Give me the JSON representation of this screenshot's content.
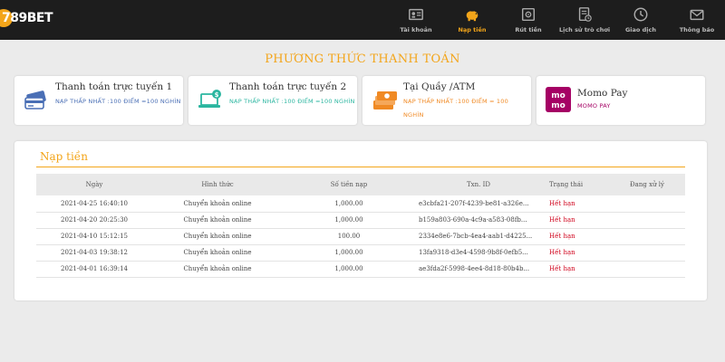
{
  "header": {
    "logo_text": "789BET",
    "nav": [
      {
        "label": "Tài khoản",
        "icon": "id-card-icon"
      },
      {
        "label": "Nạp tiền",
        "icon": "piggy-bank-icon",
        "active": true
      },
      {
        "label": "Rút tiền",
        "icon": "safe-icon"
      },
      {
        "label": "Lịch sử trò chơi",
        "icon": "history-document-icon"
      },
      {
        "label": "Giao dịch",
        "icon": "clock-icon"
      },
      {
        "label": "Thông báo",
        "icon": "envelope-icon"
      }
    ]
  },
  "page_title": "PHƯƠNG THỨC THANH TOÁN",
  "payment_methods": [
    {
      "name": "Thanh toán trực tuyến 1",
      "desc": "NẠP THẤP NHẤT :100 ĐIỂM =100 NGHÌN",
      "icon": "credit-cards-icon",
      "color": "#4a6fb5"
    },
    {
      "name": "Thanh toán trực tuyến 2",
      "desc": "NẠP THẤP NHẤT :100 ĐIỂM =100 NGHÌN",
      "icon": "laptop-dollar-icon",
      "color": "#2bb6a0"
    },
    {
      "name": "Tại Quầy /ATM",
      "desc": "NẠP THẤP NHẤT :100 ĐIỂM = 100 NGHÌN",
      "icon": "cash-stack-icon",
      "color": "#f08a24"
    },
    {
      "name": "Momo Pay",
      "desc": "MOMO PAY",
      "icon": "momo-logo-icon",
      "color": "#a50064"
    }
  ],
  "deposit": {
    "title": "Nạp tiền",
    "columns": [
      "Ngày",
      "Hình thức",
      "Số tiền nạp",
      "Txn. ID",
      "Trạng thái",
      "Đang xử lý"
    ],
    "rows": [
      [
        "2021-04-25 16:40:10",
        "Chuyển khoản online",
        "1,000.00",
        "e3cbfa21-207f-4239-be81-a326e...",
        "Hết hạn",
        ""
      ],
      [
        "2021-04-20 20:25:30",
        "Chuyển khoản online",
        "1,000.00",
        "b159a803-690a-4c9a-a583-08fb...",
        "Hết hạn",
        ""
      ],
      [
        "2021-04-10 15:12:15",
        "Chuyển khoản online",
        "100.00",
        "2334e8e6-7bcb-4ea4-aab1-d4225...",
        "Hết hạn",
        ""
      ],
      [
        "2021-04-03 19:38:12",
        "Chuyển khoản online",
        "1,000.00",
        "13fa9318-d3e4-4598-9b8f-0efb5...",
        "Hết hạn",
        ""
      ],
      [
        "2021-04-01 16:39:14",
        "Chuyển khoản online",
        "1,000.00",
        "ae3fda2f-5998-4ee4-8d18-80b4b...",
        "Hết hạn",
        ""
      ]
    ]
  },
  "colors": {
    "accent": "#f3a51a",
    "expired": "#d0021b",
    "topbar": "#1d1d1d"
  }
}
